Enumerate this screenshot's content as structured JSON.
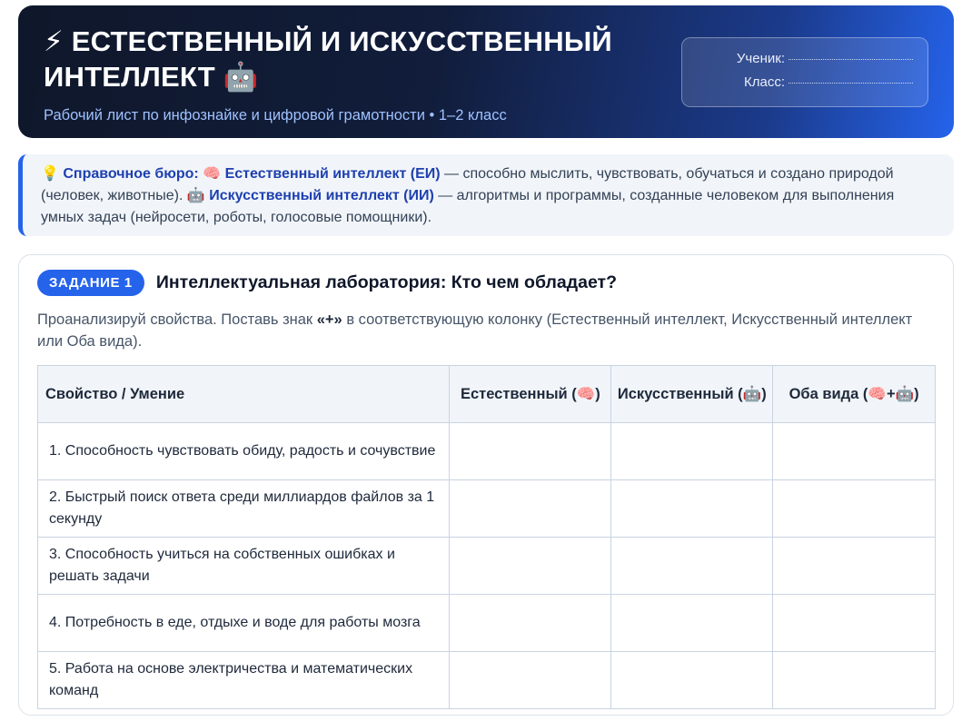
{
  "header": {
    "title": "⚡ ЕСТЕСТВЕННЫЙ И ИСКУССТВЕННЫЙ ИНТЕЛЛЕКТ 🤖",
    "subtitle": "Рабочий лист по инфознайке и цифровой грамотности • 1–2 класс",
    "student_label": "Ученик:",
    "class_label": "Класс:"
  },
  "reference": {
    "prefix": "💡",
    "label": "Справочное бюро:",
    "ei_icon": "🧠",
    "ei_term": "Естественный интеллект (ЕИ)",
    "ei_text": " — способно мыслить, чувствовать, обучаться и создано природой (человек, животные).",
    "ai_icon": "🤖",
    "ai_term": "Искусственный интеллект (ИИ)",
    "ai_text": " — алгоритмы и программы, созданные человеком для выполнения умных задач (нейросети, роботы, голосовые помощники)."
  },
  "task": {
    "badge": "ЗАДАНИЕ 1",
    "title": "Интеллектуальная лаборатория: Кто чем обладает?",
    "desc_before": "Проанализируй свойства. Поставь знак ",
    "desc_bold": "«+»",
    "desc_after": " в соответствующую колонку (Естественный интеллект, Искусственный интеллект или Оба вида).",
    "columns": [
      "Свойство / Умение",
      "Естественный (🧠)",
      "Искусственный (🤖)",
      "Оба вида (🧠+🤖)"
    ],
    "rows": [
      "1. Способность чувствовать обиду, радость и сочувствие",
      "2. Быстрый поиск ответа среди миллиардов файлов за 1 секунду",
      "3. Способность учиться на собственных ошибках и решать задачи",
      "4. Потребность в еде, отдыхе и воде для работы мозга",
      "5. Работа на основе электричества и математических команд"
    ]
  }
}
